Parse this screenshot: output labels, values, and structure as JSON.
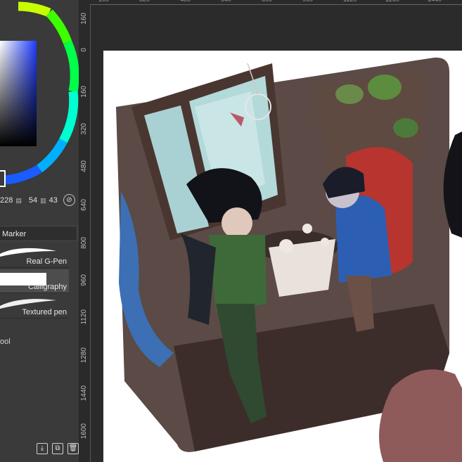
{
  "color_panel": {
    "hue_ring": "hue-wheel",
    "selected_color": "#1e36b8",
    "values": {
      "v1": "228",
      "v2": "54",
      "v3": "43"
    },
    "icons": [
      "saturation-icon",
      "value-icon",
      "eyedropper-icon"
    ]
  },
  "tool_panel": {
    "tab_label": "Marker",
    "brushes": [
      {
        "name": "Real G-Pen",
        "icon": "pen-stroke-icon"
      },
      {
        "name": "Calligraphy",
        "icon": "pen-stroke-icon"
      },
      {
        "name": "Textured pen",
        "icon": "pen-stroke-icon"
      }
    ],
    "tool_label": "ool",
    "bottom_icons": [
      "download-icon",
      "duplicate-icon",
      "trash-icon"
    ]
  },
  "ruler_vertical": {
    "labels": [
      "160",
      "0",
      "160",
      "320",
      "480",
      "640",
      "800",
      "960",
      "1120",
      "1280",
      "1440",
      "1600"
    ]
  },
  "ruler_horizontal": {
    "labels": [
      "160",
      "320",
      "480",
      "640",
      "800",
      "960",
      "1120",
      "1280",
      "1440"
    ]
  },
  "accent": "#5b9bd5"
}
